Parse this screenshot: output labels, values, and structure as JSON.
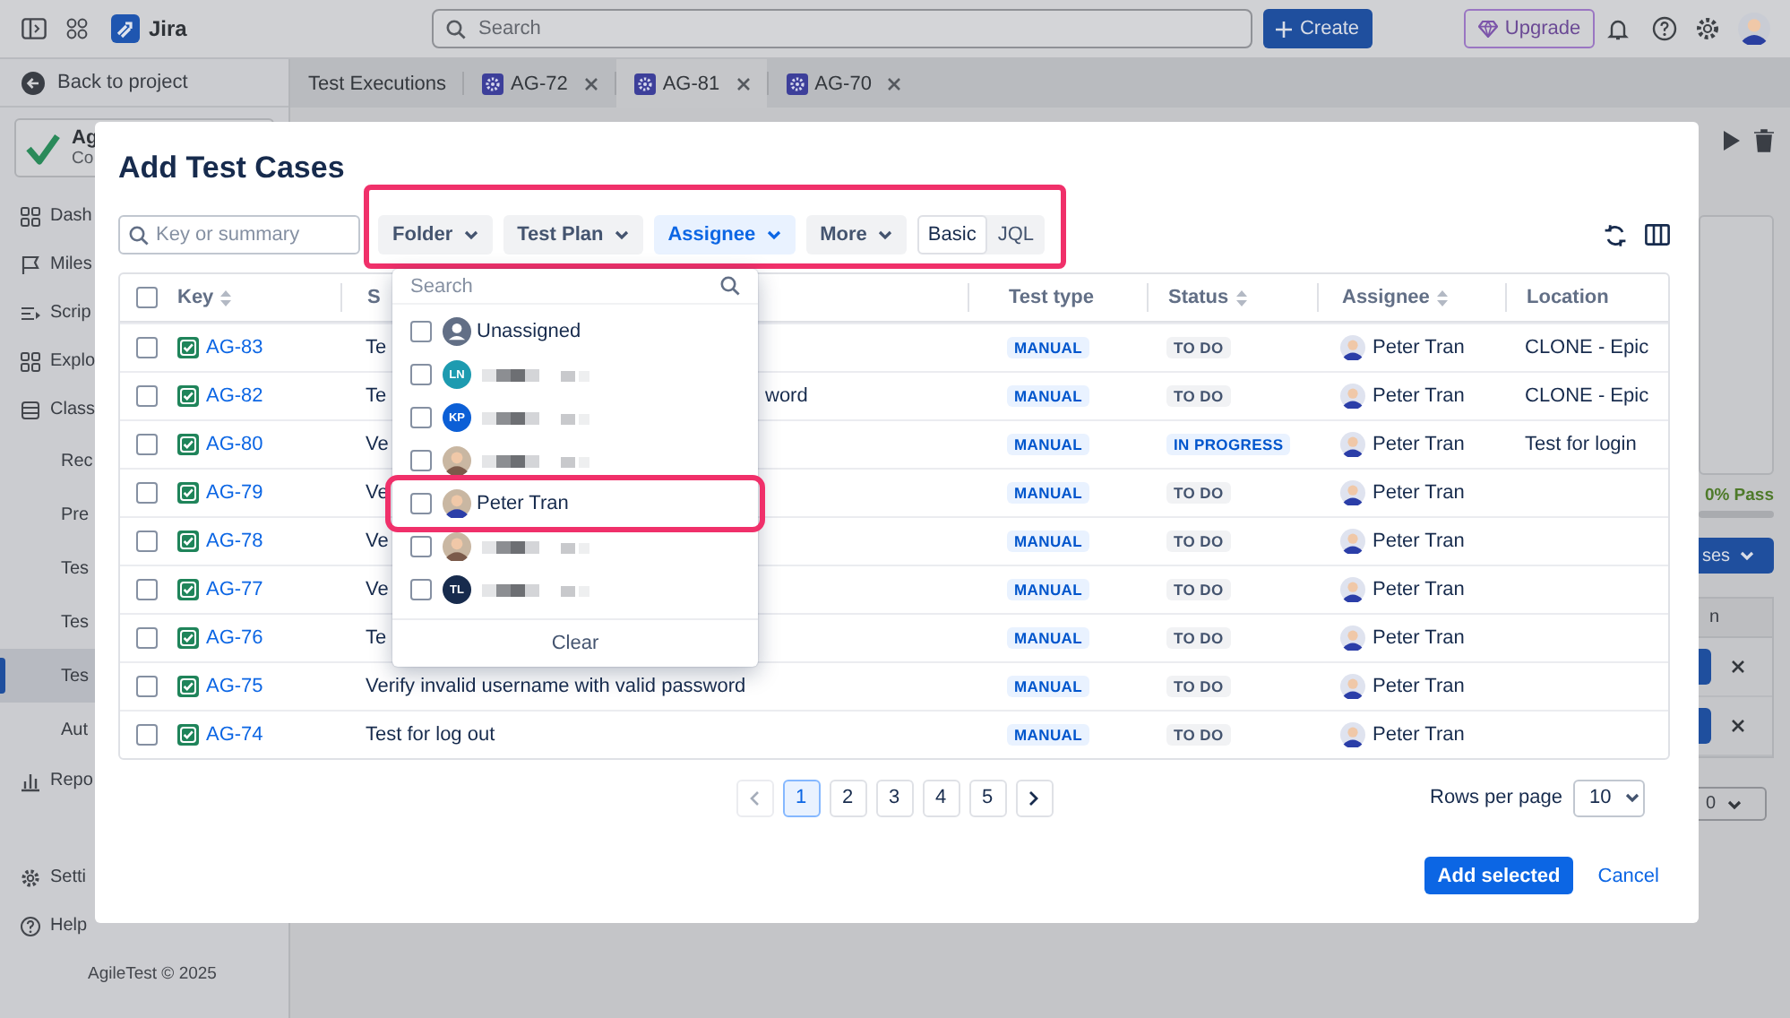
{
  "topbar": {
    "product": "Jira",
    "search": {
      "placeholder": "Search"
    },
    "create": "Create",
    "upgrade": "Upgrade"
  },
  "sidebar": {
    "back": "Back to project",
    "project": {
      "name": "Ag",
      "subtitle": "Co"
    },
    "items": [
      {
        "label": "Dash",
        "kind": "grid",
        "selected": false
      },
      {
        "label": "Miles",
        "kind": "flag",
        "selected": false
      },
      {
        "label": "Scrip",
        "kind": "list",
        "selected": false
      },
      {
        "label": "Explo",
        "kind": "grid",
        "selected": false
      },
      {
        "label": "Class",
        "kind": "table",
        "selected": false
      },
      {
        "label": "Rec",
        "kind": "sub",
        "selected": false
      },
      {
        "label": "Pre",
        "kind": "sub",
        "selected": false
      },
      {
        "label": "Tes",
        "kind": "sub",
        "selected": false
      },
      {
        "label": "Tes",
        "kind": "sub",
        "selected": false
      },
      {
        "label": "Tes",
        "kind": "sub",
        "selected": true
      },
      {
        "label": "Aut",
        "kind": "sub",
        "selected": false
      },
      {
        "label": "Repo",
        "kind": "chart",
        "selected": false
      }
    ],
    "bottom_items": [
      {
        "label": "Setti",
        "kind": "gear",
        "selected": false
      },
      {
        "label": "Help",
        "kind": "help",
        "selected": false
      }
    ],
    "footer": "AgileTest © 2025"
  },
  "tabs": [
    {
      "label": "Test Executions",
      "kind": "page",
      "selected": false
    },
    {
      "label": "AG-72",
      "kind": "issue",
      "selected": false
    },
    {
      "label": "AG-81",
      "kind": "issue",
      "selected": true
    },
    {
      "label": "AG-70",
      "kind": "issue",
      "selected": false
    }
  ],
  "main_panel": {
    "pass_rate": "0% Pass",
    "button": "ses",
    "column_header": "n",
    "rows": [
      {
        "removable": true
      },
      {
        "removable": true
      }
    ],
    "select_value": "0"
  },
  "modal": {
    "title": "Add Test Cases",
    "search": {
      "placeholder": "Key or summary"
    },
    "filters": {
      "highlighted": true,
      "items": [
        {
          "label": "Folder",
          "selected": false
        },
        {
          "label": "Test Plan",
          "selected": false
        },
        {
          "label": "Assignee",
          "selected": true
        },
        {
          "label": "More",
          "selected": false
        }
      ],
      "modes": [
        {
          "label": "Basic",
          "selected": true
        },
        {
          "label": "JQL",
          "selected": false
        }
      ]
    },
    "table": {
      "all_checked": false,
      "columns": [
        {
          "label": "Key",
          "sortable": true
        },
        {
          "label": "S",
          "sortable": false
        },
        {
          "label": "Test type",
          "sortable": false
        },
        {
          "label": "Status",
          "sortable": true
        },
        {
          "label": "Assignee",
          "sortable": true
        },
        {
          "label": "Location",
          "sortable": false
        }
      ],
      "rows": [
        {
          "checked": false,
          "key": "AG-83",
          "summary": "Te",
          "test_type": "MANUAL",
          "status": "TO DO",
          "status_active": false,
          "assignee": "Peter Tran",
          "location": "CLONE - Epic"
        },
        {
          "checked": false,
          "key": "AG-82",
          "summary": "Te",
          "summary_tail": "word",
          "test_type": "MANUAL",
          "status": "TO DO",
          "status_active": false,
          "assignee": "Peter Tran",
          "location": "CLONE - Epic"
        },
        {
          "checked": false,
          "key": "AG-80",
          "summary": "Ve",
          "test_type": "MANUAL",
          "status": "IN PROGRESS",
          "status_active": true,
          "assignee": "Peter Tran",
          "location": "Test for login"
        },
        {
          "checked": false,
          "key": "AG-79",
          "summary": "Ve",
          "test_type": "MANUAL",
          "status": "TO DO",
          "status_active": false,
          "assignee": "Peter Tran"
        },
        {
          "checked": false,
          "key": "AG-78",
          "summary": "Ve",
          "test_type": "MANUAL",
          "status": "TO DO",
          "status_active": false,
          "assignee": "Peter Tran"
        },
        {
          "checked": false,
          "key": "AG-77",
          "summary": "Ve",
          "test_type": "MANUAL",
          "status": "TO DO",
          "status_active": false,
          "assignee": "Peter Tran"
        },
        {
          "checked": false,
          "key": "AG-76",
          "summary": "Te",
          "test_type": "MANUAL",
          "status": "TO DO",
          "status_active": false,
          "assignee": "Peter Tran"
        },
        {
          "checked": false,
          "key": "AG-75",
          "summary": "Verify invalid username with valid password",
          "test_type": "MANUAL",
          "status": "TO DO",
          "status_active": false,
          "assignee": "Peter Tran"
        },
        {
          "checked": false,
          "key": "AG-74",
          "summary": "Test for log out",
          "test_type": "MANUAL",
          "status": "TO DO",
          "status_active": false,
          "assignee": "Peter Tran"
        }
      ]
    },
    "dropdown": {
      "search": {
        "placeholder": "Search"
      },
      "options": [
        {
          "kind": "unassigned",
          "label": "Unassigned",
          "checked": false,
          "highlighted": false
        },
        {
          "kind": "initials",
          "initials": "LN",
          "color": "#1d9bb0",
          "redacted": true,
          "checked": false,
          "highlighted": false
        },
        {
          "kind": "initials",
          "initials": "KP",
          "color": "#0c5fd6",
          "redacted": true,
          "checked": false,
          "highlighted": false
        },
        {
          "kind": "photo",
          "redacted": true,
          "checked": false,
          "highlighted": false
        },
        {
          "kind": "photo",
          "label": "Peter Tran",
          "checked": false,
          "highlighted": true
        },
        {
          "kind": "photo",
          "redacted": true,
          "checked": false,
          "highlighted": false
        },
        {
          "kind": "initials",
          "initials": "TL",
          "color": "#172b4d",
          "redacted": true,
          "checked": false,
          "highlighted": false
        }
      ],
      "clear": "Clear"
    },
    "pagination": {
      "prev_disabled": true,
      "next_disabled": false,
      "pages": [
        {
          "label": "1",
          "selected": true
        },
        {
          "label": "2",
          "selected": false
        },
        {
          "label": "3",
          "selected": false
        },
        {
          "label": "4",
          "selected": false
        },
        {
          "label": "5",
          "selected": false
        }
      ],
      "rows_per_page": {
        "label": "Rows per page",
        "value": "10"
      }
    },
    "actions": {
      "primary": "Add selected",
      "cancel": "Cancel"
    }
  }
}
